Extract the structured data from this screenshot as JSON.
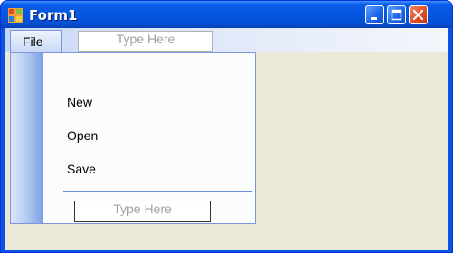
{
  "window": {
    "title": "Form1",
    "colors": {
      "titlebar": "#0a5ce8",
      "client": "#ece9d8",
      "close": "#e04a1e"
    }
  },
  "menubar": {
    "file_label": "File",
    "type_here_placeholder": "Type Here"
  },
  "dropdown": {
    "items": [
      {
        "label": "New"
      },
      {
        "label": "Open"
      },
      {
        "label": "Save"
      }
    ],
    "type_here_placeholder": "Type Here"
  },
  "icons": {
    "app": "windows-form-icon",
    "minimize": "minimize-icon",
    "maximize": "maximize-icon",
    "close": "close-icon"
  }
}
